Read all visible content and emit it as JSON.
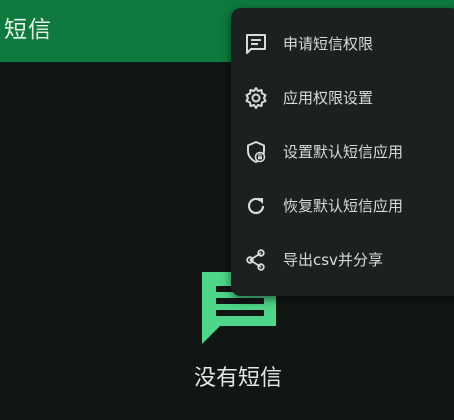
{
  "appbar": {
    "title": "短信"
  },
  "empty_state": {
    "message": "没有短信"
  },
  "menu": {
    "items": [
      {
        "label": "申请短信权限",
        "icon": "message-icon"
      },
      {
        "label": "应用权限设置",
        "icon": "gear-icon"
      },
      {
        "label": "设置默认短信应用",
        "icon": "shield-lock-icon"
      },
      {
        "label": "恢复默认短信应用",
        "icon": "refresh-icon"
      },
      {
        "label": "导出csv并分享",
        "icon": "share-icon"
      }
    ]
  },
  "colors": {
    "appbar": "#0e7a3d",
    "background": "#111513",
    "menu_background": "#1c201e",
    "accent": "#4ed68a"
  }
}
